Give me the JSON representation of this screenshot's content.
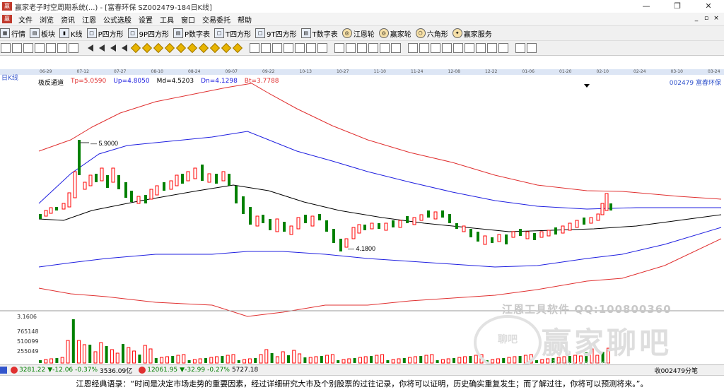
{
  "window": {
    "title": "赢家老子时空周期系统(...) - [富春环保 SZ002479-184日K线]"
  },
  "menu": [
    "文件",
    "浏览",
    "资讯",
    "江恩",
    "公式选股",
    "设置",
    "工具",
    "窗口",
    "交易委托",
    "帮助"
  ],
  "toolbar1": [
    {
      "label": "行情",
      "icon": "grid-icon"
    },
    {
      "label": "板块",
      "icon": "blocks-icon"
    },
    {
      "label": "K线",
      "icon": "candle-icon"
    },
    {
      "label": "P四方形",
      "icon": "square-icon"
    },
    {
      "label": "9P四方形",
      "icon": "square-icon"
    },
    {
      "label": "P数字表",
      "icon": "table-icon"
    },
    {
      "label": "T四方形",
      "icon": "square-icon"
    },
    {
      "label": "9T四方形",
      "icon": "square-icon"
    },
    {
      "label": "T数字表",
      "icon": "table-icon"
    },
    {
      "label": "江恩轮",
      "icon": "wheel-icon"
    },
    {
      "label": "赢家轮",
      "icon": "wheel-icon"
    },
    {
      "label": "六角形",
      "icon": "hexagon-icon"
    },
    {
      "label": "赢家服务",
      "icon": "service-icon"
    }
  ],
  "period_label": "日K线",
  "indicator": {
    "name": "极反通道",
    "tp": "Tp=5.0590",
    "up": "Up=4.8050",
    "md": "Md=4.5203",
    "dn": "Dn=4.1298",
    "bt": "Bt=3.7788"
  },
  "stock_label": "002479 富春环保",
  "dates": [
    "06-29",
    "07-12",
    "07-27",
    "08-10",
    "08-24",
    "09-07",
    "09-22",
    "10-13",
    "10-27",
    "11-10",
    "11-24",
    "12-08",
    "12-22",
    "01-06",
    "01-20",
    "02-10",
    "02-24",
    "03-10",
    "03-24"
  ],
  "annotations": {
    "high": "5.9000",
    "low": "4.1800"
  },
  "volume_axis": [
    "3.1606",
    "765148",
    "510099",
    "255049"
  ],
  "watermark": {
    "line1": "江恩工具软件  QQ:100800360",
    "line2": "赢家聊吧",
    "logo": "聊吧",
    "url": "jiaoba.yo.com"
  },
  "status": {
    "sh": "3281.22",
    "sh_change": "▼-12.06",
    "sh_pct": "-0.37%",
    "sh_amt": "3536.09亿",
    "sz": "12061.95",
    "sz_change": "▼-32.99",
    "sz_pct": "-0.27%",
    "sz_amt": "5727.18",
    "right": "收002479分笔"
  },
  "footer": "江恩经典语录：“时间是决定市场走势的重要因素，经过详细研究大市及个别股票的过往记录，你将可以证明，历史确实重复发生；而了解过往，你将可以预测将来。”。",
  "colors": {
    "up": "#ff0000",
    "down": "#008000",
    "band_outer": "#e03030",
    "band_mid": "#2020e0",
    "md_line": "#000000"
  }
}
